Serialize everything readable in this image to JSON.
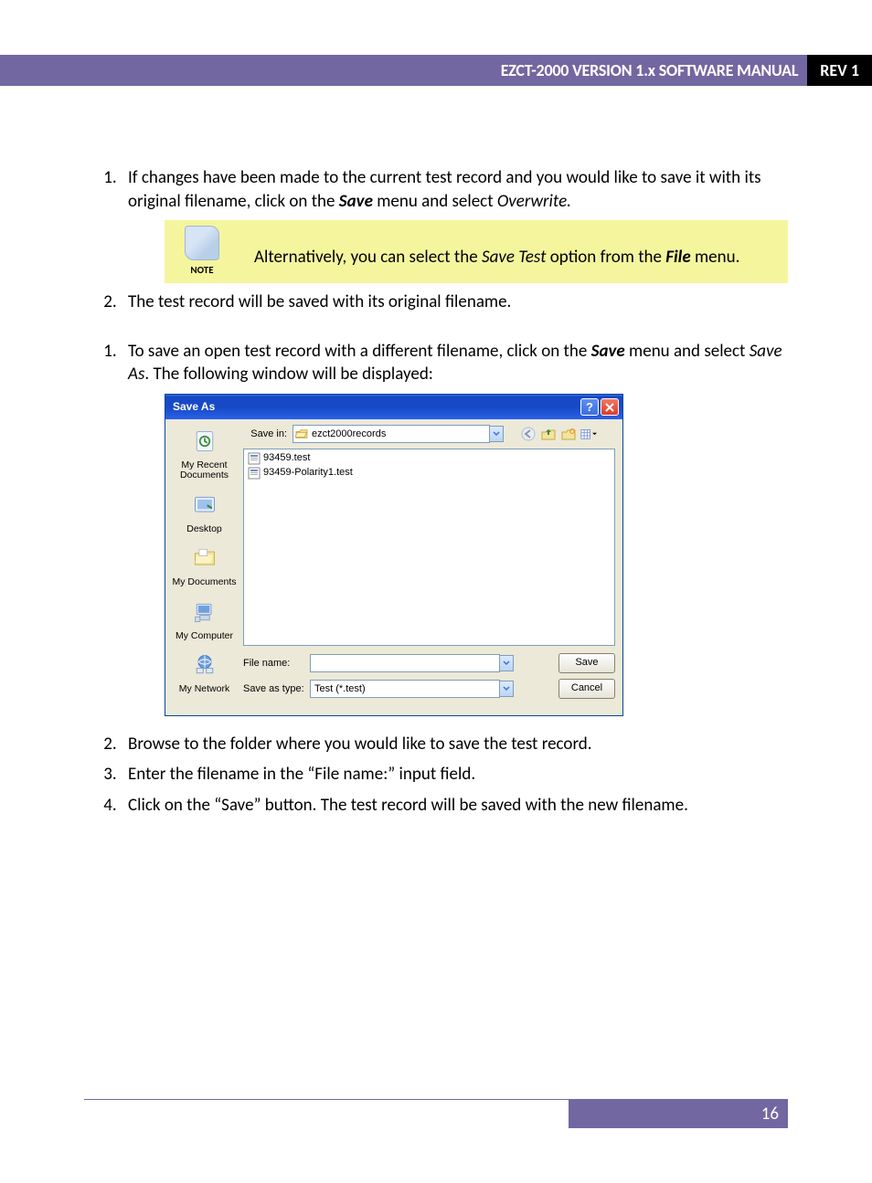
{
  "header": {
    "title": "EZCT-2000 VERSION 1.x SOFTWARE MANUAL",
    "rev": "REV 1"
  },
  "listA": {
    "item1_pre": "If changes have been made to the current test record and you would like to save it with its original filename, click on the ",
    "item1_bold1": "Save",
    "item1_mid": " menu and select ",
    "item1_it": "Overwrite.",
    "item2": "The test record will be saved with its original filename."
  },
  "note": {
    "label": "NOTE",
    "text_pre": "Alternatively, you can select the ",
    "text_it1": "Save Test",
    "text_mid": " option from the ",
    "text_bold": "File",
    "text_post": " menu."
  },
  "listB": {
    "item1_pre": "To save an open test record with a different filename, click on the ",
    "item1_bold": "Save",
    "item1_mid": " menu and select ",
    "item1_it": "Save As",
    "item1_post": ". The following window will be displayed:",
    "item2": "Browse to the folder where you would like to save the test record.",
    "item3": "Enter the filename in the “File name:” input field.",
    "item4": "Click on the “Save” button. The test record will be saved with the new filename."
  },
  "dialog": {
    "title": "Save As",
    "savein_label": "Save in:",
    "savein_value": "ezct2000records",
    "files": [
      "93459.test",
      "93459-Polarity1.test"
    ],
    "places": {
      "recent": "My Recent Documents",
      "desktop": "Desktop",
      "mydocs": "My Documents",
      "mycomp": "My Computer",
      "mynet": "My Network"
    },
    "filename_label": "File name:",
    "filename_value": "",
    "savetype_label": "Save as type:",
    "savetype_value": "Test (*.test)",
    "save_btn": "Save",
    "cancel_btn": "Cancel"
  },
  "footer": {
    "page": "16"
  }
}
